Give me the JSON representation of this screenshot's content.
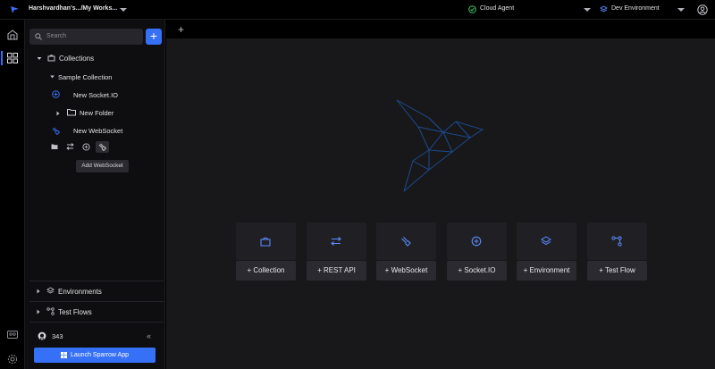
{
  "header": {
    "workspace": "Harshvardhan's.../My Works...",
    "agent": "Cloud Agent",
    "environment": "Dev Environment"
  },
  "search": {
    "placeholder": "Search"
  },
  "sidebar": {
    "collections_label": "Collections",
    "sample_collection": "Sample Collection",
    "items": [
      "New Socket.IO",
      "New Folder",
      "New WebSocket"
    ],
    "tooltip": "Add WebSocket",
    "environments_label": "Environments",
    "test_flows_label": "Test Flows",
    "github_count": "343",
    "launch_label": "Launch Sparrow App"
  },
  "tabs": {
    "new_tab": "+"
  },
  "quick_actions": [
    {
      "label": "+ Collection",
      "icon": "collection-icon"
    },
    {
      "label": "+ REST API",
      "icon": "rest-api-icon"
    },
    {
      "label": "+ WebSocket",
      "icon": "websocket-icon"
    },
    {
      "label": "+ Socket.IO",
      "icon": "socketio-icon"
    },
    {
      "label": "+ Environment",
      "icon": "environment-icon"
    },
    {
      "label": "+ Test Flow",
      "icon": "test-flow-icon"
    }
  ],
  "colors": {
    "accent": "#3670f7",
    "success": "#3ecf6b"
  }
}
